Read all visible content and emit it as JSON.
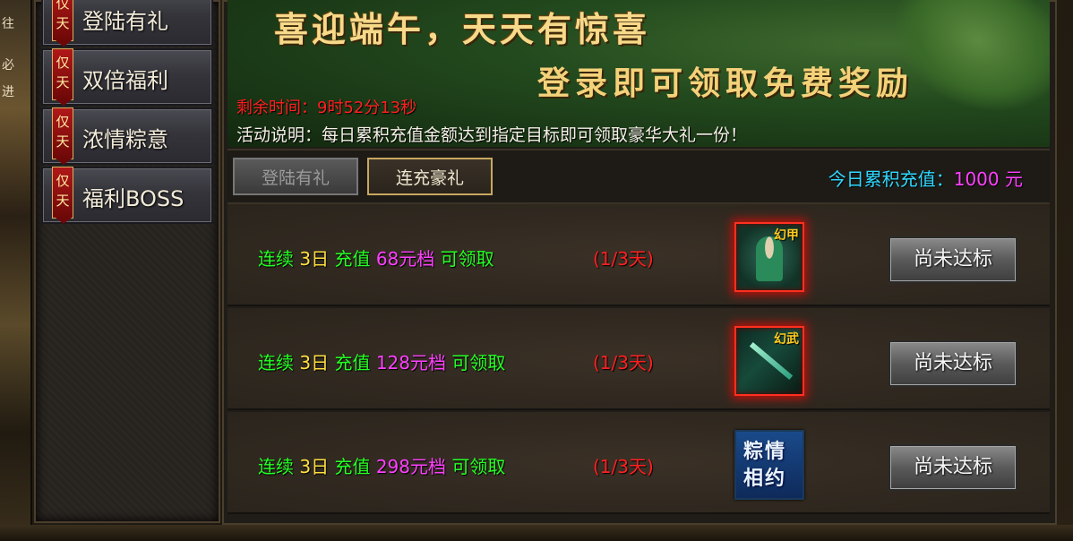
{
  "left_strip": [
    "往",
    "必",
    "进"
  ],
  "sidebar": {
    "items": [
      {
        "tag": "仅天",
        "tag_top": "仅",
        "tag_bottom": "天",
        "label": "登陆有礼"
      },
      {
        "tag": "仅天",
        "tag_top": "仅",
        "tag_bottom": "天",
        "label": "双倍福利"
      },
      {
        "tag": "仅天",
        "tag_top": "仅",
        "tag_bottom": "天",
        "label": "浓情粽意"
      },
      {
        "tag": "仅天",
        "tag_top": "仅",
        "tag_bottom": "天",
        "label": "福利BOSS"
      }
    ]
  },
  "banner": {
    "headline": "喜迎端午，天天有惊喜",
    "subline": "登录即可领取免费奖励",
    "timer": "剩余时间：9时52分13秒",
    "description": "活动说明：每日累积充值金额达到指定目标即可领取豪华大礼一份！"
  },
  "tabs": [
    {
      "label": "登陆有礼",
      "active": false
    },
    {
      "label": "连充豪礼",
      "active": true
    }
  ],
  "recharge": {
    "label": "今日累积充值：",
    "amount": "1000",
    "unit": " 元"
  },
  "rows": [
    {
      "prefix": "连续 ",
      "days": "3日",
      "mid": " 充值 ",
      "tier": "68元档",
      "suffix": " 可领取",
      "progress": "(1/3天)",
      "reward_badge": "幻甲",
      "reward_icon": "armor-icon",
      "button": "尚未达标"
    },
    {
      "prefix": "连续 ",
      "days": "3日",
      "mid": " 充值 ",
      "tier": "128元档",
      "suffix": " 可领取",
      "progress": "(1/3天)",
      "reward_badge": "幻武",
      "reward_icon": "weapon-icon",
      "button": "尚未达标"
    },
    {
      "prefix": "连续 ",
      "days": "3日",
      "mid": " 充值 ",
      "tier": "298元档",
      "suffix": " 可领取",
      "progress": "(1/3天)",
      "reward_text_top": "粽情",
      "reward_text_bottom": "相约",
      "reward_icon": "zongqing-xiangyue-icon",
      "button": "尚未达标"
    }
  ],
  "colors": {
    "highlight_green": "#24ff24",
    "day_yellow": "#ffe040",
    "tier_magenta": "#ff40ff",
    "progress_red": "#ff2020",
    "recharge_cyan": "#2fd8ff"
  }
}
